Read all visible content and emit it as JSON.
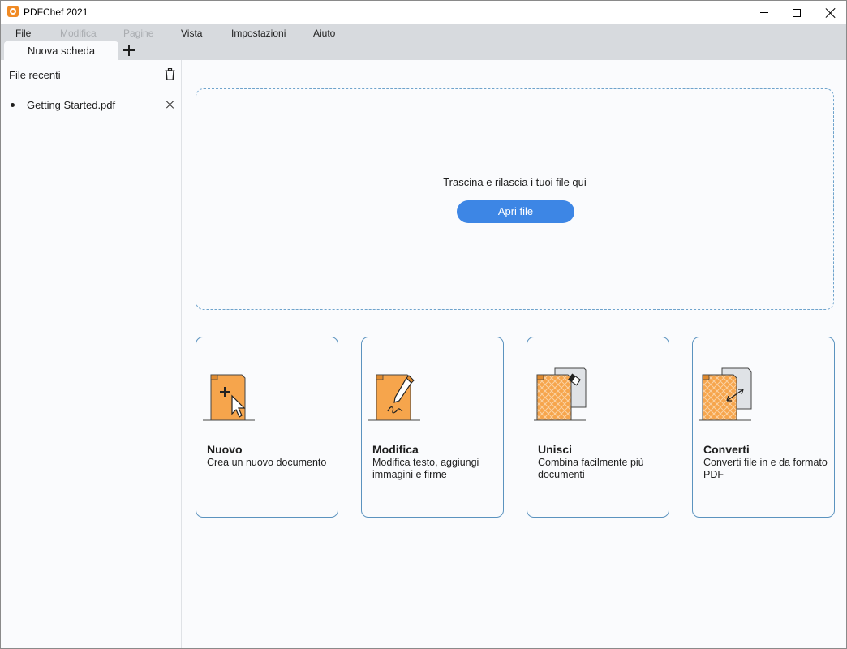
{
  "window": {
    "title": "PDFChef 2021"
  },
  "menu": {
    "items": [
      {
        "label": "File",
        "enabled": true
      },
      {
        "label": "Modifica",
        "enabled": false
      },
      {
        "label": "Pagine",
        "enabled": false
      },
      {
        "label": "Vista",
        "enabled": true
      },
      {
        "label": "Impostazioni",
        "enabled": true
      },
      {
        "label": "Aiuto",
        "enabled": true
      }
    ]
  },
  "tabs": {
    "active_label": "Nuova scheda"
  },
  "sidebar": {
    "heading": "File recenti",
    "recent_files": [
      {
        "name": "Getting Started.pdf"
      }
    ]
  },
  "dropzone": {
    "text": "Trascina e rilascia i tuoi file qui",
    "button_label": "Apri file"
  },
  "cards": [
    {
      "title": "Nuovo",
      "description": "Crea un nuovo documento",
      "icon": "new-document-icon"
    },
    {
      "title": "Modifica",
      "description": "Modifica testo, aggiungi immagini e firme",
      "icon": "edit-document-icon"
    },
    {
      "title": "Unisci",
      "description": "Combina facilmente più documenti",
      "icon": "merge-documents-icon"
    },
    {
      "title": "Converti",
      "description": "Converti file in e da formato PDF",
      "icon": "convert-document-icon"
    }
  ],
  "colors": {
    "accent": "#3d86e5",
    "card_border": "#5b93bf",
    "illustration_orange": "#f6a54c",
    "chrome_gray": "#d7dade"
  }
}
